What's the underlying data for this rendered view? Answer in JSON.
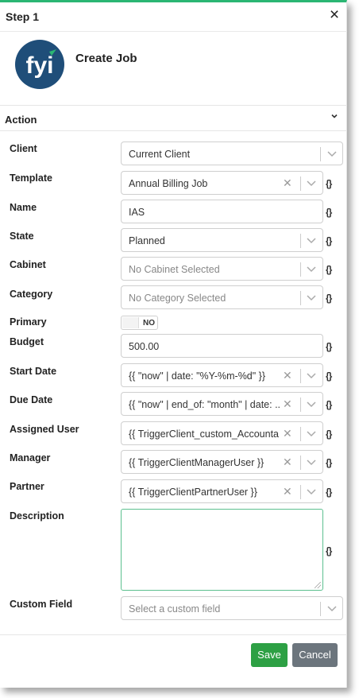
{
  "dialog": {
    "title": "Step 1",
    "close_icon": "×"
  },
  "app": {
    "title": "Create Job",
    "logo_text": "fyi"
  },
  "section": {
    "label": "Action"
  },
  "fields": {
    "client": {
      "label": "Client",
      "value": "Current Client"
    },
    "template": {
      "label": "Template",
      "value": "Annual Billing Job"
    },
    "name": {
      "label": "Name",
      "value": "IAS"
    },
    "state": {
      "label": "State",
      "value": "Planned"
    },
    "cabinet": {
      "label": "Cabinet",
      "placeholder": "No Cabinet Selected"
    },
    "category": {
      "label": "Category",
      "placeholder": "No Category Selected"
    },
    "primary": {
      "label": "Primary",
      "toggle_text": "NO"
    },
    "budget": {
      "label": "Budget",
      "value": "500.00"
    },
    "start_date": {
      "label": "Start Date",
      "value": "{{ \"now\" | date: \"%Y-%m-%d\" }}"
    },
    "due_date": {
      "label": "Due Date",
      "value": "{{ \"now\" | end_of: \"month\" | date: ..."
    },
    "assigned_user": {
      "label": "Assigned User",
      "value": "{{ TriggerClient_custom_Accounta..."
    },
    "manager": {
      "label": "Manager",
      "value": "{{ TriggerClientManagerUser }}"
    },
    "partner": {
      "label": "Partner",
      "value": "{{ TriggerClientPartnerUser }}"
    },
    "description": {
      "label": "Description",
      "value": ""
    },
    "custom_field": {
      "label": "Custom Field",
      "placeholder": "Select a custom field"
    }
  },
  "variable_icon": "{}",
  "buttons": {
    "save": "Save",
    "cancel": "Cancel"
  },
  "colors": {
    "accent": "#2bb673",
    "save": "#2da044",
    "cancel": "#6c757d",
    "logo_bg": "#1f4e79"
  }
}
